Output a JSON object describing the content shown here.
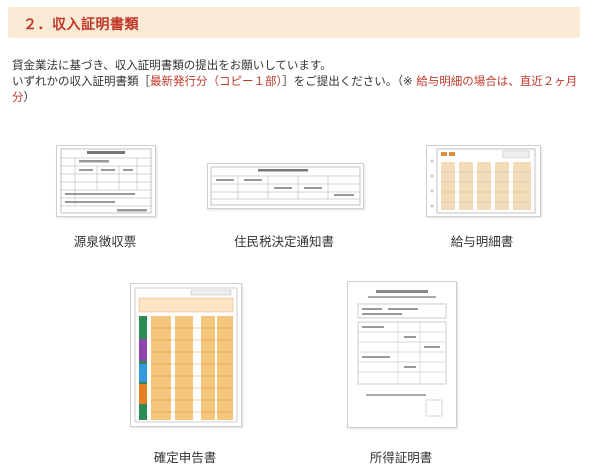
{
  "section": {
    "title": "２．収入証明書類"
  },
  "intro": {
    "line1": "貸金業法に基づき、収入証明書類の提出をお願いしています。",
    "line2_prefix": "いずれかの収入証明書類［",
    "line2_red": "最新発行分（コピー１部）",
    "line2_suffix": "］をご提出ください。（※ ",
    "note_red": "給与明細の場合は、直近２ヶ月分",
    "note_close": "）"
  },
  "documents": [
    {
      "label": "源泉徴収票"
    },
    {
      "label": "住民税決定通知書"
    },
    {
      "label": "給与明細書"
    },
    {
      "label": "確定申告書"
    },
    {
      "label": "所得証明書"
    }
  ],
  "colors": {
    "header_bg": "#f9ead6",
    "header_text": "#c0392b",
    "accent_red": "#c0392b",
    "form_orange": "#f0a030",
    "form_gray": "#888888"
  }
}
